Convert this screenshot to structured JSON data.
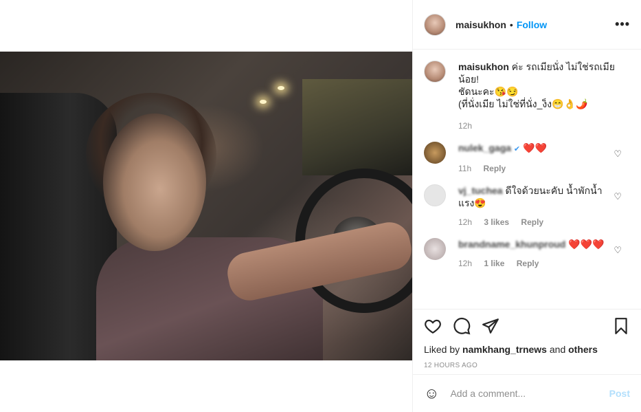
{
  "post": {
    "username": "maisukhon",
    "follow_label": "Follow",
    "more_label": "•••",
    "dot": "•"
  },
  "caption": {
    "username": "maisukhon",
    "text": "ค่ะ รถเมียนั่ง ไม่ใช่รถเมียน้อย!",
    "line2": "ชัดนะคะ😘😏",
    "line3": "(ที่นั่งเมีย ไม่ใช่ที่นั่ง_ง็ง😁👌🌶️",
    "time": "12h"
  },
  "comments": [
    {
      "username": "nulek_gaga",
      "verified": "✔",
      "text": "❤️❤️",
      "time": "11h",
      "likes": "",
      "reply": "Reply"
    },
    {
      "username": "vj_tuchea",
      "text": "ดีใจด้วยนะคับ น้ำพักน้ำแรง😍",
      "time": "12h",
      "likes": "3 likes",
      "reply": "Reply"
    },
    {
      "username": "brandname_khunproud",
      "text": "❤️❤️❤️",
      "time": "12h",
      "likes": "1 like",
      "reply": "Reply"
    }
  ],
  "actions": {
    "liked_by_prefix": "Liked by",
    "liked_by_user": "namkhang_trnews",
    "liked_by_and": "and",
    "liked_by_others": "others",
    "timestamp": "12 HOURS AGO"
  },
  "add_comment": {
    "placeholder": "Add a comment...",
    "post_label": "Post"
  },
  "colors": {
    "accent": "#0095f6",
    "post_disabled": "#b2dffc",
    "muted": "#8e8e8e"
  }
}
